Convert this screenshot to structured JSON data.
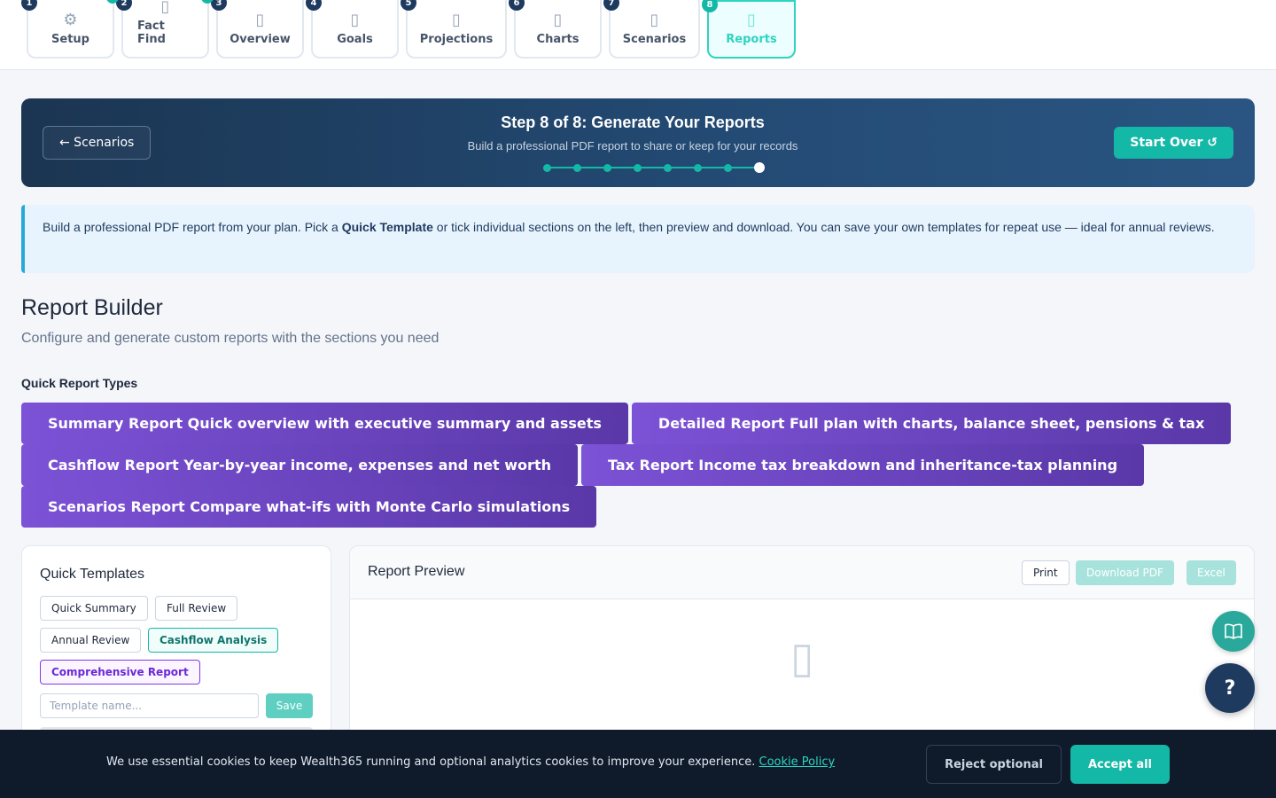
{
  "steps": [
    {
      "num": "1",
      "label": "Setup",
      "icon": "⚙"
    },
    {
      "num": "2",
      "label": "Fact Find",
      "icon": "▯"
    },
    {
      "num": "3",
      "label": "Overview",
      "icon": "▯"
    },
    {
      "num": "4",
      "label": "Goals",
      "icon": "▯"
    },
    {
      "num": "5",
      "label": "Projections",
      "icon": "▯"
    },
    {
      "num": "6",
      "label": "Charts",
      "icon": "▯"
    },
    {
      "num": "7",
      "label": "Scenarios",
      "icon": "▯"
    },
    {
      "num": "8",
      "label": "Reports",
      "icon": "▯"
    }
  ],
  "hero": {
    "back_label": "← Scenarios",
    "title": "Step 8 of 8: Generate Your Reports",
    "subtitle": "Build a professional PDF report to share or keep for your records",
    "start_over_label": "Start Over ↺",
    "current_step": 8,
    "total_steps": 8
  },
  "info": {
    "prefix": "Build a professional PDF report from your plan. Pick a ",
    "bold": "Quick Template",
    "suffix": " or tick individual sections on the left, then preview and download. You can save your own templates for repeat use — ideal for annual reviews."
  },
  "builder": {
    "title": "Report Builder",
    "subtitle": "Configure and generate custom reports with the sections you need",
    "quick_types_label": "Quick Report Types"
  },
  "report_types": [
    "Summary Report Quick overview with executive summary and assets",
    "Detailed Report Full plan with charts, balance sheet, pensions & tax",
    "Cashflow Report Year-by-year income, expenses and net worth",
    "Tax Report Income tax breakdown and inheritance-tax planning",
    "Scenarios Report Compare what-ifs with Monte Carlo simulations"
  ],
  "templates": {
    "title": "Quick Templates",
    "chips": [
      "Quick Summary",
      "Full Review",
      "Annual Review",
      "Cashflow Analysis",
      "Comprehensive Report"
    ],
    "input_placeholder": "Template name...",
    "save_label": "Save"
  },
  "preview": {
    "title": "Report Preview",
    "print_label": "Print",
    "pdf_label": "Download PDF",
    "excel_label": "Excel",
    "doc_icon": "▯"
  },
  "fab": {
    "guide_icon": "📖",
    "help_label": "?"
  },
  "cookie": {
    "text": "We use essential cookies to keep Wealth365 running and optional analytics cookies to improve your experience. ",
    "link": "Cookie Policy",
    "reject_label": "Reject optional",
    "accept_label": "Accept all"
  },
  "colors": {
    "accent": "#14b8a6",
    "navy": "#1e3a5f",
    "purple": "#6d44c4"
  }
}
